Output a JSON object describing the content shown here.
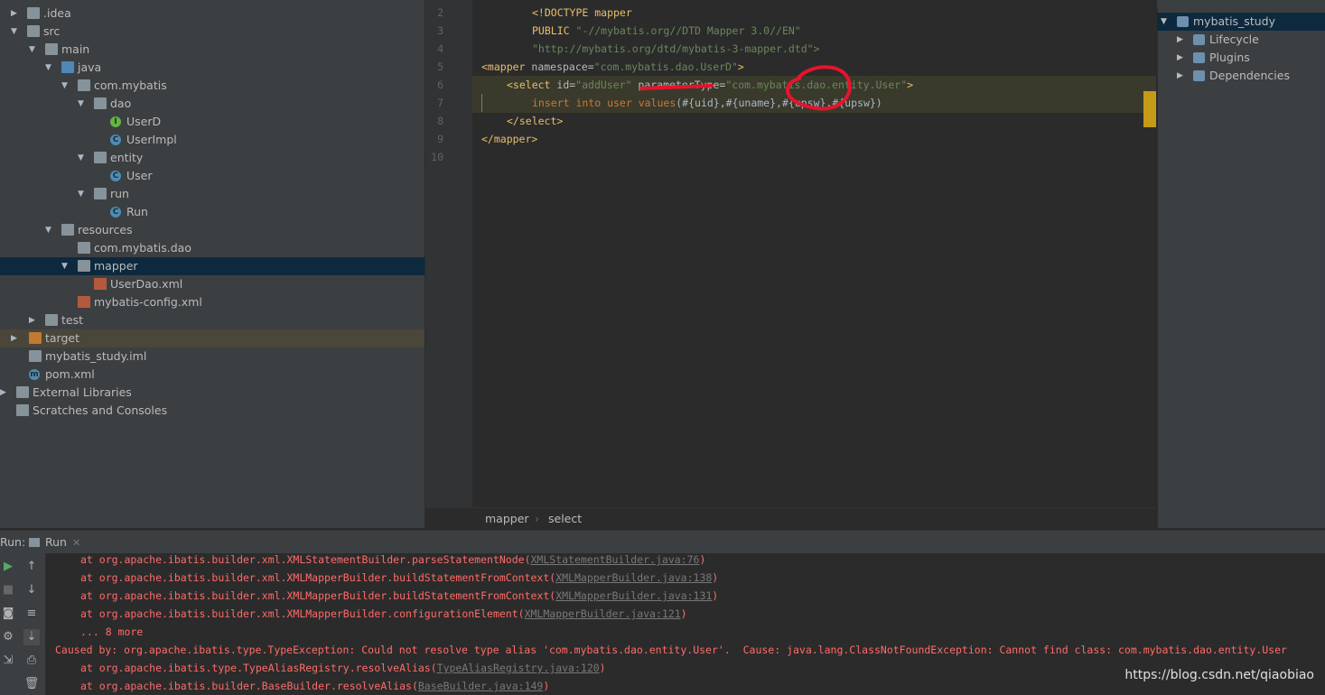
{
  "project_tree": [
    {
      "label": ".idea",
      "icon": "folder-icon"
    },
    {
      "label": "src",
      "icon": "folder-icon"
    },
    {
      "label": "main",
      "icon": "folder-icon"
    },
    {
      "label": "java",
      "icon": "source-folder-icon"
    },
    {
      "label": "com.mybatis",
      "icon": "package-icon"
    },
    {
      "label": "dao",
      "icon": "package-icon"
    },
    {
      "label": "UserD",
      "icon": "interface-icon",
      "glyph": "I"
    },
    {
      "label": "UserImpl",
      "icon": "class-icon",
      "glyph": "C"
    },
    {
      "label": "entity",
      "icon": "package-icon"
    },
    {
      "label": "User",
      "icon": "class-icon",
      "glyph": "C"
    },
    {
      "label": "run",
      "icon": "package-icon"
    },
    {
      "label": "Run",
      "icon": "class-icon",
      "glyph": "C"
    },
    {
      "label": "resources",
      "icon": "resources-folder-icon"
    },
    {
      "label": "com.mybatis.dao",
      "icon": "folder-icon"
    },
    {
      "label": "mapper",
      "icon": "folder-icon"
    },
    {
      "label": "UserDao.xml",
      "icon": "xml-file-icon"
    },
    {
      "label": "mybatis-config.xml",
      "icon": "xml-file-icon"
    },
    {
      "label": "test",
      "icon": "folder-icon"
    },
    {
      "label": "target",
      "icon": "excluded-folder-icon"
    },
    {
      "label": "mybatis_study.iml",
      "icon": "iml-file-icon"
    },
    {
      "label": "pom.xml",
      "icon": "maven-file-icon",
      "glyph": "m"
    },
    {
      "label": "External Libraries",
      "icon": "libraries-icon"
    },
    {
      "label": "Scratches and Consoles",
      "icon": "scratches-icon"
    }
  ],
  "editor": {
    "line_numbers": [
      "2",
      "3",
      "4",
      "5",
      "6",
      "7",
      "8",
      "9",
      "10"
    ],
    "doctype": "<!DOCTYPE mapper",
    "public_kw": "PUBLIC ",
    "public_id": "\"-//mybatis.org//DTD Mapper 3.0//EN\"",
    "dtd_url": "\"http://mybatis.org/dtd/mybatis-3-mapper.dtd\">",
    "mapper_open": "<mapper ",
    "namespace_attr": "namespace=",
    "namespace_val": "\"com.mybatis.dao.UserD\"",
    "select_open": "<select ",
    "id_attr": "id=",
    "id_val": "\"addUser\"",
    "param_attr": " parameterType=",
    "param_val": "\"com.mybatis.dao.entity.User\"",
    "sql_insert": "insert into user values",
    "sql_values": "(#{uid},#{uname},#{upsw},#{upsw})",
    "select_close": "</select>",
    "mapper_close": "</mapper>",
    "breadcrumb": [
      "mapper",
      "select"
    ]
  },
  "maven": {
    "items": [
      {
        "label": "mybatis_study",
        "icon": "maven-project-icon"
      },
      {
        "label": "Lifecycle",
        "icon": "lifecycle-icon"
      },
      {
        "label": "Plugins",
        "icon": "plugins-icon"
      },
      {
        "label": "Dependencies",
        "icon": "dependencies-icon"
      }
    ]
  },
  "run": {
    "label": "Run:",
    "tab": "Run",
    "lines": [
      {
        "prefix": "at org.apache.ibatis.builder.xml.XMLStatementBuilder.parseStatementNode(",
        "link": "XMLStatementBuilder.java:76",
        "suffix": ")"
      },
      {
        "prefix": "at org.apache.ibatis.builder.xml.XMLMapperBuilder.buildStatementFromContext(",
        "link": "XMLMapperBuilder.java:138",
        "suffix": ")"
      },
      {
        "prefix": "at org.apache.ibatis.builder.xml.XMLMapperBuilder.buildStatementFromContext(",
        "link": "XMLMapperBuilder.java:131",
        "suffix": ")"
      },
      {
        "prefix": "at org.apache.ibatis.builder.xml.XMLMapperBuilder.configurationElement(",
        "link": "XMLMapperBuilder.java:121",
        "suffix": ")"
      },
      {
        "prefix": "... 8 more",
        "link": "",
        "suffix": ""
      },
      {
        "prefix": "Caused by: org.apache.ibatis.type.TypeException: Could not resolve type alias 'com.mybatis.dao.entity.User'.  Cause: java.lang.ClassNotFoundException: Cannot find class: com.mybatis.dao.entity.User",
        "link": "",
        "suffix": ""
      },
      {
        "prefix": "at org.apache.ibatis.type.TypeAliasRegistry.resolveAlias(",
        "link": "TypeAliasRegistry.java:120",
        "suffix": ")"
      },
      {
        "prefix": "at org.apache.ibatis.builder.BaseBuilder.resolveAlias(",
        "link": "BaseBuilder.java:149",
        "suffix": ")"
      }
    ]
  },
  "watermark": "https://blog.csdn.net/qiaobiao",
  "colors": {
    "selection": "#0d293e",
    "error_text": "#ff6b68",
    "annotation": "#e8132c"
  }
}
